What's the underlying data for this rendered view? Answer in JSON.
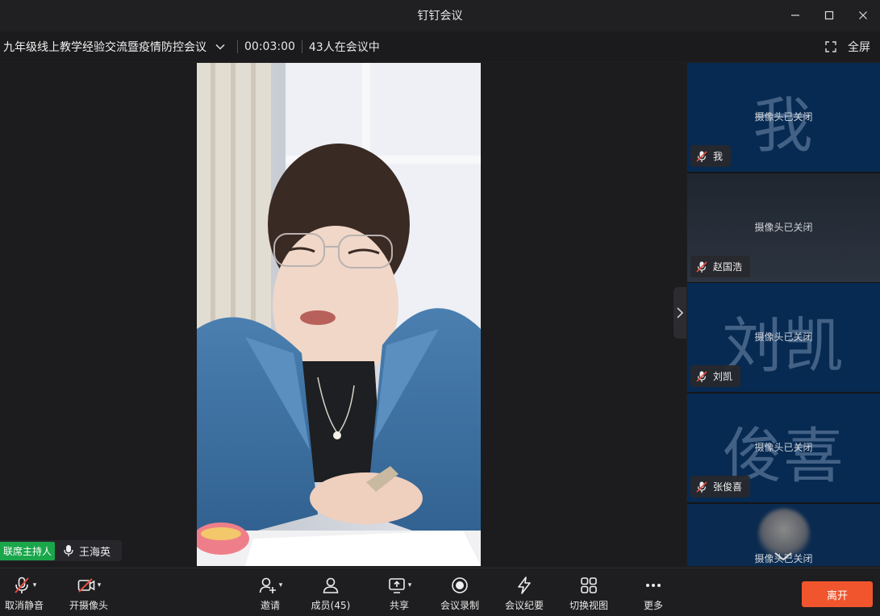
{
  "window": {
    "title": "钉钉会议"
  },
  "infobar": {
    "meeting_name": "九年级线上教学经验交流暨疫情防控会议",
    "timer": "00:03:00",
    "participants_text": "43人在会议中",
    "fullscreen_label": "全屏"
  },
  "stage": {
    "host_badge": "联席主持人",
    "host_name": "王海英"
  },
  "panel": {
    "cam_off_text": "摄像头已关闭",
    "tiles": [
      {
        "avatar": "我",
        "name": "我"
      },
      {
        "avatar": "",
        "name": "赵国浩"
      },
      {
        "avatar": "刘凯",
        "name": "刘凯"
      },
      {
        "avatar": "俊喜",
        "name": "张俊喜"
      },
      {
        "avatar": "",
        "name": ""
      }
    ]
  },
  "toolbar": {
    "unmute": "取消静音",
    "camera": "开摄像头",
    "invite": "邀请",
    "members": "成员(45)",
    "share": "共享",
    "record": "会议录制",
    "minutes": "会议纪要",
    "switch_view": "切换视图",
    "more": "更多",
    "leave": "离开"
  },
  "colors": {
    "leave": "#f0552d",
    "host_badge": "#1aa64a",
    "tile_bg": "#072a52"
  }
}
